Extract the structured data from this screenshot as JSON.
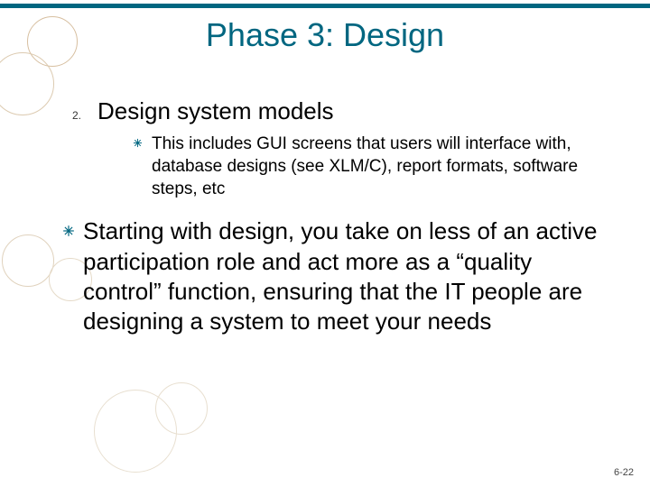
{
  "title": "Phase 3: Design",
  "item": {
    "number": "2.",
    "text": "Design system models",
    "sub": "This includes GUI screens that users will interface with, database designs (see XLM/C), report formats, software steps, etc"
  },
  "paragraph": "Starting with design, you take on less of an active participation role and act more as a “quality control” function, ensuring that the IT people are designing a system to meet your needs",
  "page_number": "6-22"
}
